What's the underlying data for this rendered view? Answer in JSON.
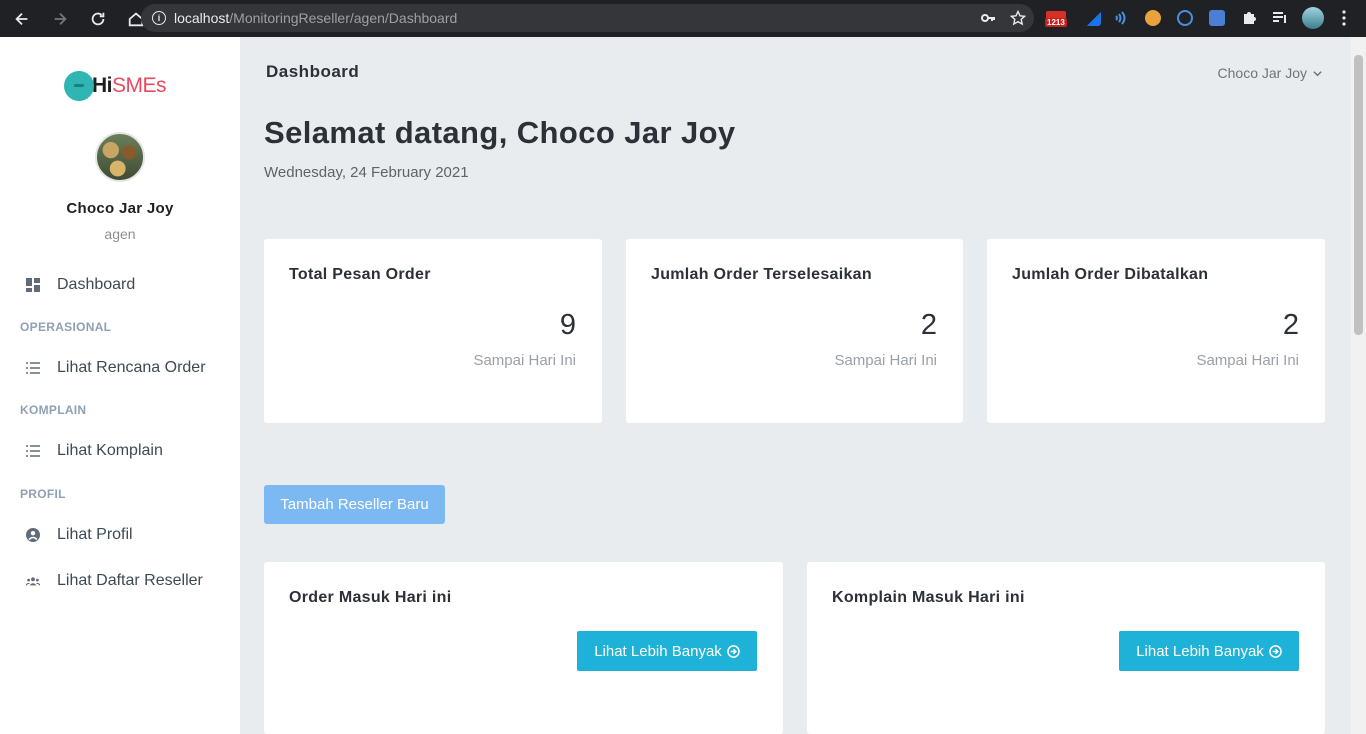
{
  "browser": {
    "url_host": "localhost",
    "url_path": "/MonitoringReseller/agen/Dashboard",
    "gmail_badge": "1213"
  },
  "sidebar": {
    "logo_hi": "Hi",
    "logo_smes": "SMEs",
    "user_name": "Choco Jar Joy",
    "user_role": "agen",
    "items": [
      {
        "label": "Dashboard",
        "icon": "dashboard-icon"
      },
      {
        "label": "Lihat Rencana Order",
        "icon": "list-icon"
      },
      {
        "label": "Lihat Komplain",
        "icon": "list-icon"
      },
      {
        "label": "Lihat Profil",
        "icon": "user-circle-icon"
      },
      {
        "label": "Lihat Daftar Reseller",
        "icon": "group-icon"
      }
    ],
    "sections": [
      "OPERASIONAL",
      "KOMPLAIN",
      "PROFIL"
    ]
  },
  "header": {
    "title": "Dashboard",
    "user_menu": "Choco Jar Joy"
  },
  "main": {
    "welcome": "Selamat datang, Choco Jar Joy",
    "date": "Wednesday, 24 February 2021",
    "stats": [
      {
        "title": "Total Pesan Order",
        "value": "9",
        "sub": "Sampai Hari Ini"
      },
      {
        "title": "Jumlah Order Terselesaikan",
        "value": "2",
        "sub": "Sampai Hari Ini"
      },
      {
        "title": "Jumlah Order Dibatalkan",
        "value": "2",
        "sub": "Sampai Hari Ini"
      }
    ],
    "add_button": "Tambah Reseller Baru",
    "panels": [
      {
        "title": "Order Masuk Hari ini",
        "button": "Lihat Lebih Banyak"
      },
      {
        "title": "Komplain Masuk Hari ini",
        "button": "Lihat Lebih Banyak"
      }
    ]
  },
  "colors": {
    "accent_button": "#1fb2d8",
    "add_button": "#7cb8f2",
    "background": "#e9ecef"
  }
}
